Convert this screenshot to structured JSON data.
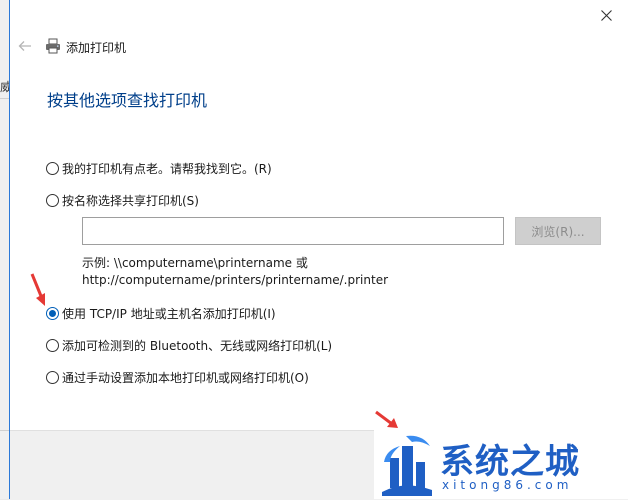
{
  "background_window": {
    "fragment_text": "威"
  },
  "dialog": {
    "title": "添加打印机",
    "heading": "按其他选项查找打印机",
    "options": [
      {
        "label": "我的打印机有点老。请帮我找到它。(R)",
        "checked": false
      },
      {
        "label": "按名称选择共享打印机(S)",
        "checked": false
      },
      {
        "label": "使用 TCP/IP 地址或主机名添加打印机(I)",
        "checked": true
      },
      {
        "label": "添加可检测到的 Bluetooth、无线或网络打印机(L)",
        "checked": false
      },
      {
        "label": "通过手动设置添加本地打印机或网络打印机(O)",
        "checked": false
      }
    ],
    "share_input": {
      "value": ""
    },
    "browse_button": "浏览(R)...",
    "example_line1": "示例: \\\\computername\\printername 或",
    "example_line2": "http://computername/printers/printername/.printer"
  },
  "watermark": {
    "name": "系统之城",
    "url": "xitong86.com"
  },
  "colors": {
    "accent": "#005fb8",
    "heading": "#003f8a",
    "arrow": "#e53935",
    "watermark": "#1f5fc4"
  }
}
